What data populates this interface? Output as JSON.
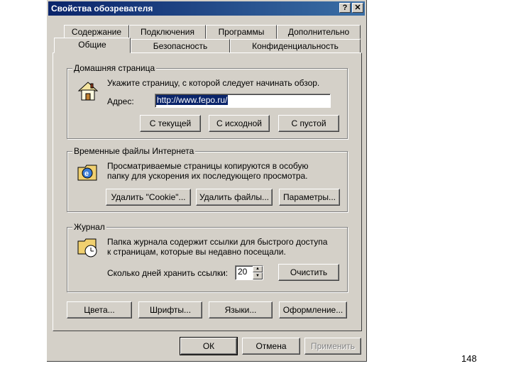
{
  "window": {
    "title": "Свойства обозревателя",
    "help_btn": "?",
    "close_btn": "✕"
  },
  "tabs": {
    "row_top": [
      "Содержание",
      "Подключения",
      "Программы",
      "Дополнительно"
    ],
    "row_bottom": [
      "Общие",
      "Безопасность",
      "Конфиденциальность"
    ]
  },
  "home": {
    "label": "Домашняя страница",
    "desc": "Укажите страницу, с которой следует начинать обзор.",
    "address_label": "Адрес:",
    "address_value": "http://www.fepo.ru/",
    "btn_current": "С текущей",
    "btn_default": "С исходной",
    "btn_blank": "С пустой"
  },
  "temp": {
    "label": "Временные файлы Интернета",
    "desc1": "Просматриваемые страницы копируются в особую",
    "desc2": "папку для ускорения их последующего просмотра.",
    "btn_cookie": "Удалить \"Cookie\"...",
    "btn_files": "Удалить файлы...",
    "btn_params": "Параметры..."
  },
  "history": {
    "label": "Журнал",
    "desc1": "Папка журнала содержит ссылки для быстрого доступа",
    "desc2": "к страницам, которые вы недавно посещали.",
    "days_label": "Сколько дней хранить ссылки:",
    "days_value": "20",
    "btn_clear": "Очистить"
  },
  "bottom_buttons": [
    "Цвета...",
    "Шрифты...",
    "Языки...",
    "Оформление..."
  ],
  "footer": {
    "ok": "ОК",
    "cancel": "Отмена",
    "apply": "Применить"
  },
  "page_number": "148"
}
